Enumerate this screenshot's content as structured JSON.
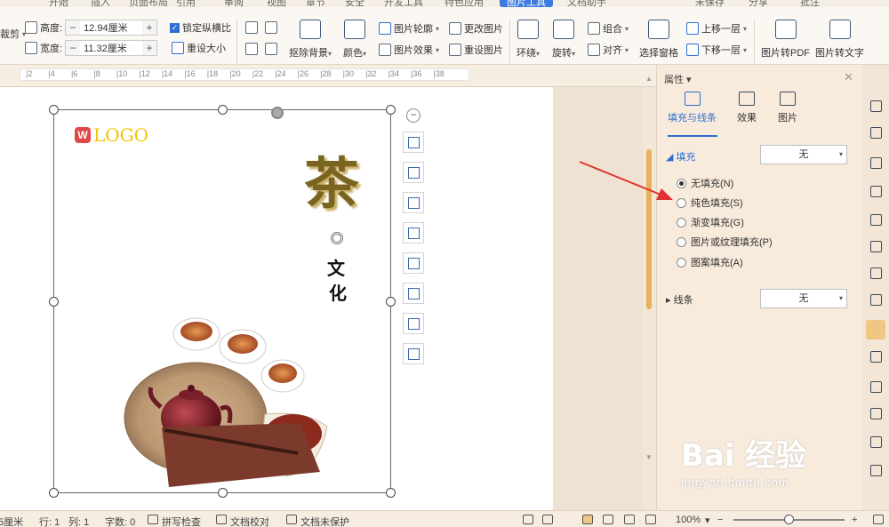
{
  "tabstrip": {
    "tabs": [
      "开始",
      "插入",
      "页面布局",
      "引用",
      "审阅",
      "视图",
      "章节",
      "安全",
      "开发工具",
      "特色应用",
      "图片工具",
      "文档助手",
      "未保存",
      "分享",
      "批注"
    ],
    "active": "图片工具"
  },
  "ribbon": {
    "crop_label": "裁剪",
    "height_label": "高度:",
    "height_value": "12.94厘米",
    "width_label": "宽度:",
    "width_value": "11.32厘米",
    "lock_ratio_label": "锁定纵横比",
    "reset_size_label": "重设大小",
    "remove_bg_label": "抠除背景",
    "color_label": "颜色",
    "picture_outline_label": "图片轮廓",
    "picture_effect_label": "图片效果",
    "change_picture_label": "更改图片",
    "reset_picture_label": "重设图片",
    "wrap_label": "环绕",
    "rotate_label": "旋转",
    "group_label": "组合",
    "align_label": "对齐",
    "selection_pane_label": "选择窗格",
    "bring_forward_label": "上移一层",
    "send_backward_label": "下移一层",
    "to_pdf_label": "图片转PDF",
    "to_text_label": "图片转文字"
  },
  "ruler": {
    "ticks": [
      "2",
      "4",
      "6",
      "8",
      "10",
      "12",
      "14",
      "16",
      "18",
      "20",
      "22",
      "24",
      "26",
      "28",
      "30",
      "32",
      "34",
      "36",
      "38"
    ]
  },
  "artwork": {
    "logo_mark": "W",
    "logo_text": "LOGO",
    "title_char": "茶",
    "char_wen": "文",
    "char_hua": "化"
  },
  "panel": {
    "title": "属性",
    "tabs": [
      "填充与线条",
      "效果",
      "图片"
    ],
    "fill_section": "填充",
    "fill_value": "无",
    "fill_options": [
      "无填充(N)",
      "纯色填充(S)",
      "渐变填充(G)",
      "图片或纹理填充(P)",
      "图案填充(A)"
    ],
    "selected_option": 0,
    "line_section": "线条",
    "line_value": "无"
  },
  "status": {
    "position": "5厘米",
    "row": "行: 1",
    "col": "列: 1",
    "word_count": "字数: 0",
    "spell_check": "拼写检查",
    "doc_proofread": "文档校对",
    "doc_unprotected": "文档未保护",
    "zoom": "100%"
  },
  "watermark": {
    "brand": "Bai 经验",
    "url": "jingyan.baidu.com"
  },
  "colors": {
    "accent": "#2f6fd1",
    "arrow": "#e03030",
    "ribbon_bg": "#fbf7f2",
    "panel_bg": "#f8ebdc"
  }
}
